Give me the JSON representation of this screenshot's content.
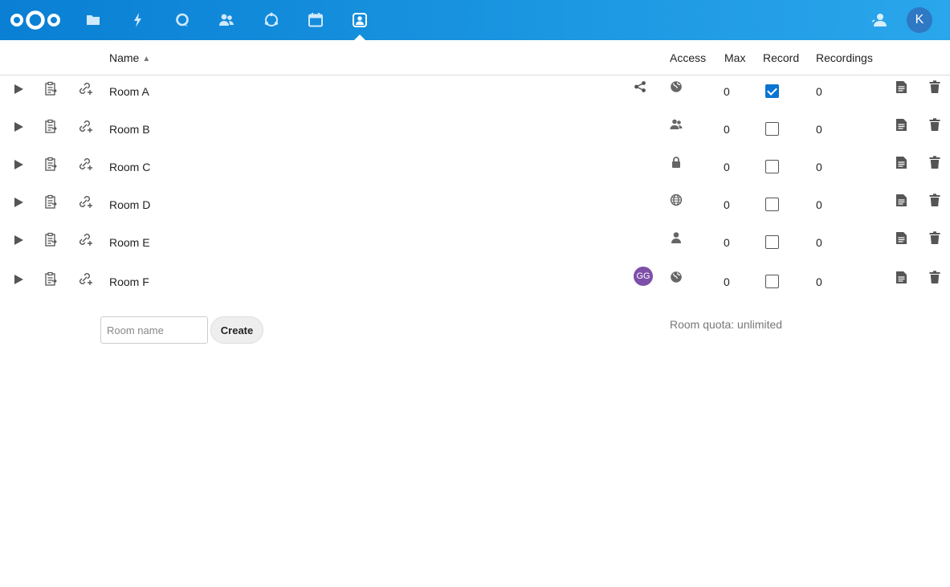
{
  "header": {
    "apps": [
      {
        "name": "files-icon"
      },
      {
        "name": "activity-icon"
      },
      {
        "name": "talk-icon"
      },
      {
        "name": "contacts-icon"
      },
      {
        "name": "circles-icon"
      },
      {
        "name": "calendar-icon"
      },
      {
        "name": "bbb-rooms-icon"
      }
    ],
    "active_app": "bbb-rooms-icon",
    "user_initial": "K",
    "brand_color": "#0a7fd4"
  },
  "table": {
    "columns": {
      "name": "Name",
      "access": "Access",
      "max": "Max",
      "record": "Record",
      "recordings": "Recordings"
    },
    "sort_indicator": "▲",
    "rows": [
      {
        "name": "Room A",
        "shared_icon": "share-icon",
        "shared_avatar": "",
        "access_icon": "globe-icon",
        "max": "0",
        "record": true,
        "recordings": "0"
      },
      {
        "name": "Room B",
        "shared_icon": "",
        "shared_avatar": "",
        "access_icon": "users-icon",
        "max": "0",
        "record": false,
        "recordings": "0"
      },
      {
        "name": "Room C",
        "shared_icon": "",
        "shared_avatar": "",
        "access_icon": "lock-icon",
        "max": "0",
        "record": false,
        "recordings": "0"
      },
      {
        "name": "Room D",
        "shared_icon": "",
        "shared_avatar": "",
        "access_icon": "globe-outline-icon",
        "max": "0",
        "record": false,
        "recordings": "0"
      },
      {
        "name": "Room E",
        "shared_icon": "",
        "shared_avatar": "",
        "access_icon": "user-icon",
        "max": "0",
        "record": false,
        "recordings": "0"
      },
      {
        "name": "Room F",
        "shared_icon": "",
        "shared_avatar": "GG",
        "access_icon": "globe-icon",
        "max": "0",
        "record": false,
        "recordings": "0"
      }
    ]
  },
  "form": {
    "room_name_placeholder": "Room name",
    "create_label": "Create"
  },
  "quota_text": "Room quota: unlimited"
}
